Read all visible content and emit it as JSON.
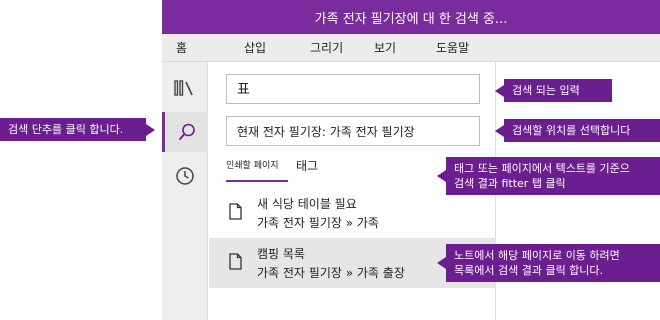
{
  "window": {
    "title": "가족 전자 필기장에 대 한 검색 중..."
  },
  "ribbon": {
    "tabs": [
      "홈",
      "삽입",
      "그리기",
      "보기",
      "도움말"
    ]
  },
  "sidebar": {
    "icons": [
      "library-icon",
      "search-icon",
      "recent-icon"
    ]
  },
  "search": {
    "query": "표",
    "scope": "현재 전자 필기장: 가족 전자 필기장"
  },
  "filters": {
    "pages_label": "인쇄할 페이지",
    "tags_label": "태그",
    "active": "pages"
  },
  "results": [
    {
      "title": "새 식당 테이블 필요",
      "path": "가족 전자 필기장 » 가족"
    },
    {
      "title": "캠핑 목록",
      "path": "가족 전자 필기장 » 가족 출장"
    }
  ],
  "callouts": {
    "search_button": "검색 단추를 클릭 합니다.",
    "search_input": "검색 되는 입력",
    "scope": "검색할 위치를 선택합니다",
    "filter_line1": "태그 또는 페이지에서 텍스트를 기준으",
    "filter_line2": "검색 결과 fitter 탭 클릭",
    "result_line1": "노트에서 해당 페이지로 이동 하려면",
    "result_line2": "목록에서 검색 결과 클릭 합니다."
  },
  "colors": {
    "accent": "#7a2c9e",
    "callout": "#6b1e8f",
    "selected_row": "#e6e6e6"
  }
}
